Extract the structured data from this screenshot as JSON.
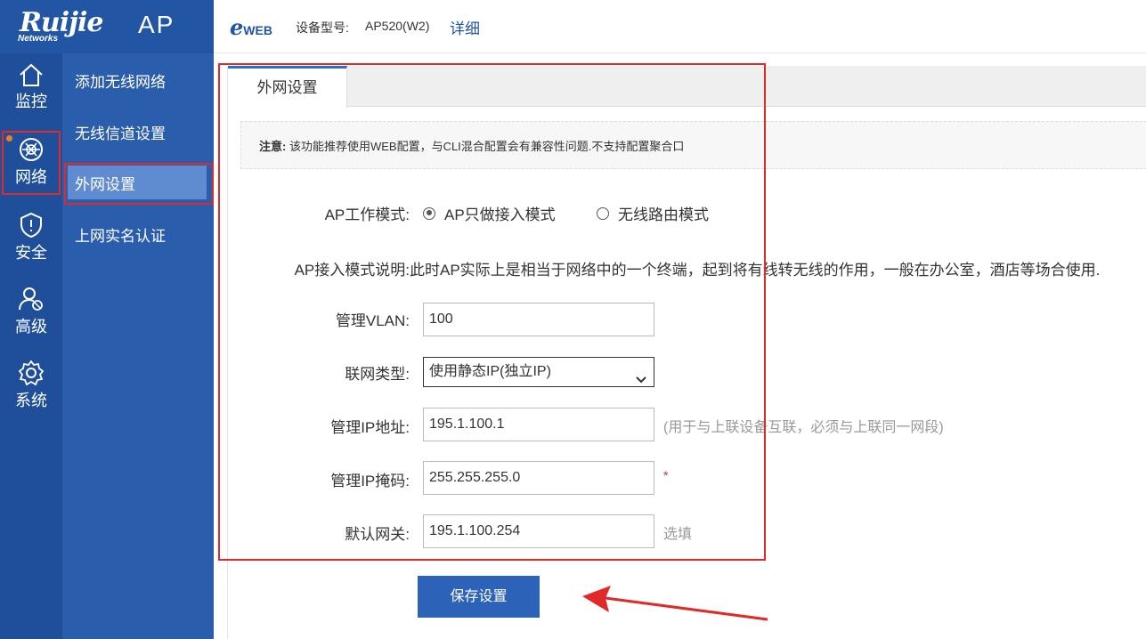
{
  "brand": {
    "logo": "Ruijie",
    "logo_sub": "Networks",
    "product": "AP",
    "eweb_e": "e",
    "eweb_rest": "WEB"
  },
  "header": {
    "model_label": "设备型号:",
    "model_value": "AP520(W2)",
    "detail_link": "详细"
  },
  "nav": {
    "items": [
      {
        "label": "监控",
        "icon": "home-icon"
      },
      {
        "label": "网络",
        "icon": "network-globe-icon",
        "active": true
      },
      {
        "label": "安全",
        "icon": "shield-icon"
      },
      {
        "label": "高级",
        "icon": "user-settings-icon"
      },
      {
        "label": "系统",
        "icon": "gear-icon"
      }
    ]
  },
  "subnav": {
    "items": [
      {
        "label": "添加无线网络"
      },
      {
        "label": "无线信道设置"
      },
      {
        "label": "外网设置",
        "active": true
      },
      {
        "label": "上网实名认证"
      }
    ]
  },
  "tab": {
    "label": "外网设置"
  },
  "notice": {
    "prefix": "注意:",
    "text": " 该功能推荐使用WEB配置，与CLI混合配置会有兼容性问题.不支持配置聚合口"
  },
  "form": {
    "mode_label": "AP工作模式:",
    "mode_options": [
      "AP只做接入模式",
      "无线路由模式"
    ],
    "mode_selected": "AP只做接入模式",
    "desc_label": "AP接入模式说明:",
    "desc_text": "此时AP实际上是相当于网络中的一个终端，起到将有线转无线的作用，一般在办公室，酒店等场合使用.",
    "vlan_label": "管理VLAN:",
    "vlan_value": "100",
    "conn_label": "联网类型:",
    "conn_value": "使用静态IP(独立IP)",
    "ip_label": "管理IP地址:",
    "ip_value": "195.1.100.1",
    "ip_hint": "(用于与上联设备互联，必须与上联同一网段)",
    "mask_label": "管理IP掩码:",
    "mask_value": "255.255.255.0",
    "mask_required": "*",
    "gw_label": "默认网关:",
    "gw_value": "195.1.100.254",
    "gw_hint": "选填"
  },
  "save_label": "保存设置",
  "colors": {
    "sidebar": "#285cac",
    "accent": "#2c63b8",
    "highlight": "#e02a2a",
    "badge": "#f57c1f"
  }
}
